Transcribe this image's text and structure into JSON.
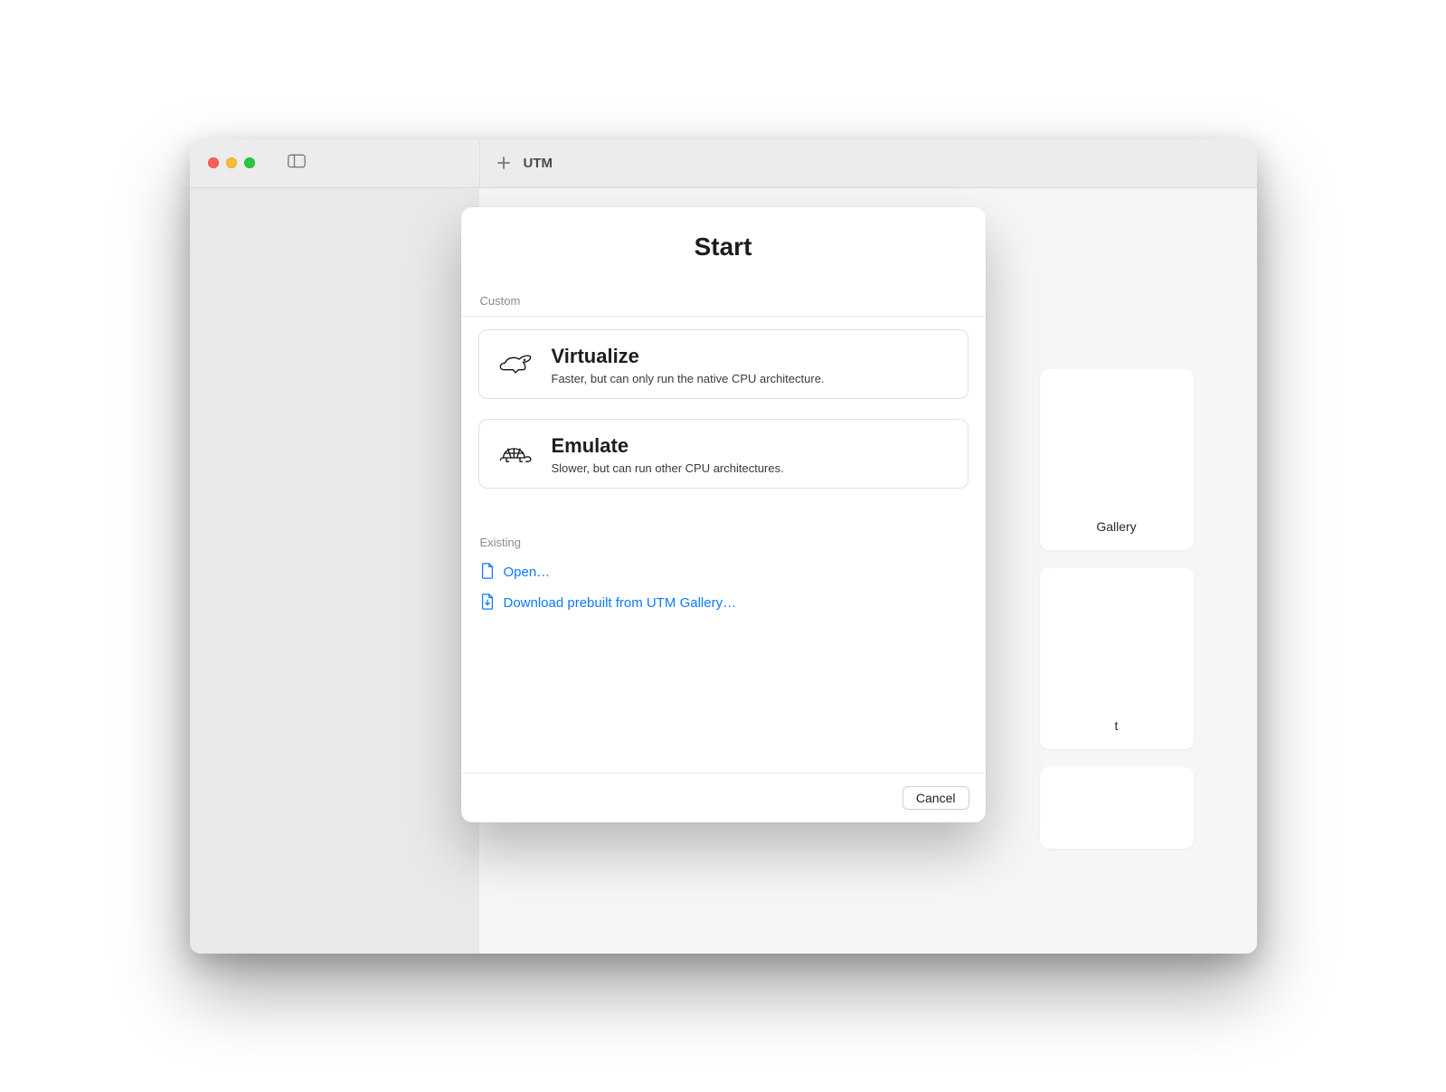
{
  "app": {
    "title": "UTM"
  },
  "background_tiles": {
    "gallery_label": "Gallery",
    "support_label": "t"
  },
  "sheet": {
    "title": "Start",
    "section_custom": "Custom",
    "section_existing": "Existing",
    "options": [
      {
        "title": "Virtualize",
        "desc": "Faster, but can only run the native CPU architecture."
      },
      {
        "title": "Emulate",
        "desc": "Slower, but can run other CPU architectures."
      }
    ],
    "links": {
      "open": "Open…",
      "download": "Download prebuilt from UTM Gallery…"
    },
    "cancel": "Cancel"
  }
}
